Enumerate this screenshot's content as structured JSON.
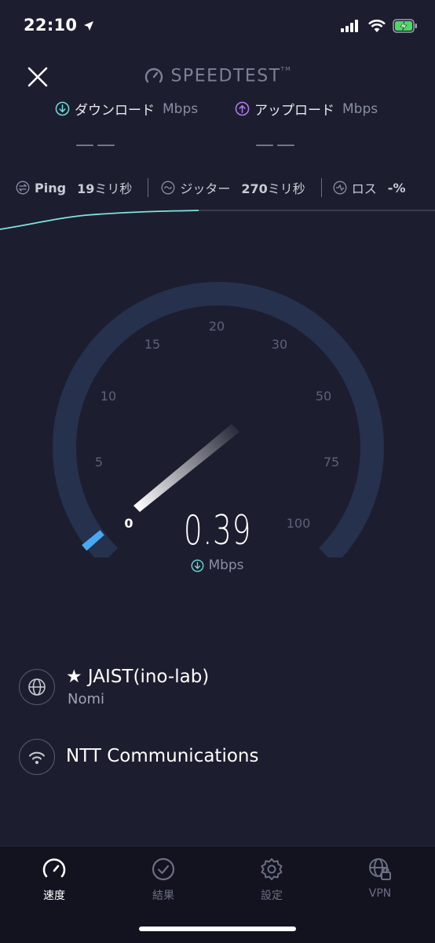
{
  "status_bar": {
    "time": "22:10"
  },
  "header": {
    "brand": "SPEEDTEST",
    "close_icon": "close-icon"
  },
  "metrics": {
    "download": {
      "label": "ダウンロード",
      "unit": "Mbps",
      "value": "——"
    },
    "upload": {
      "label": "アップロード",
      "unit": "Mbps",
      "value": "——"
    }
  },
  "stats": {
    "ping": {
      "label": "Ping",
      "value": "19",
      "unit": "ミリ秒"
    },
    "jitter": {
      "label": "ジッター",
      "value": "270",
      "unit": "ミリ秒"
    },
    "loss": {
      "label": "ロス",
      "value": "-%"
    }
  },
  "gauge": {
    "ticks": [
      "0",
      "5",
      "10",
      "15",
      "20",
      "30",
      "50",
      "75",
      "100"
    ],
    "current_speed": "0.39",
    "unit": "Mbps"
  },
  "server": {
    "name": "★ JAIST(ino-lab)",
    "location": "Nomi"
  },
  "isp": {
    "name": "NTT Communications"
  },
  "tabs": [
    {
      "label": "速度",
      "icon": "speedometer-icon",
      "active": true
    },
    {
      "label": "結果",
      "icon": "checkmark-circle-icon",
      "active": false
    },
    {
      "label": "設定",
      "icon": "gear-icon",
      "active": false
    },
    {
      "label": "VPN",
      "icon": "globe-lock-icon",
      "active": false
    }
  ],
  "colors": {
    "background": "#1c1e2f",
    "download_accent": "#6fdcdc",
    "upload_accent": "#b17cf0",
    "gauge_track": "#26314d",
    "progress": "#4aa8f0"
  }
}
